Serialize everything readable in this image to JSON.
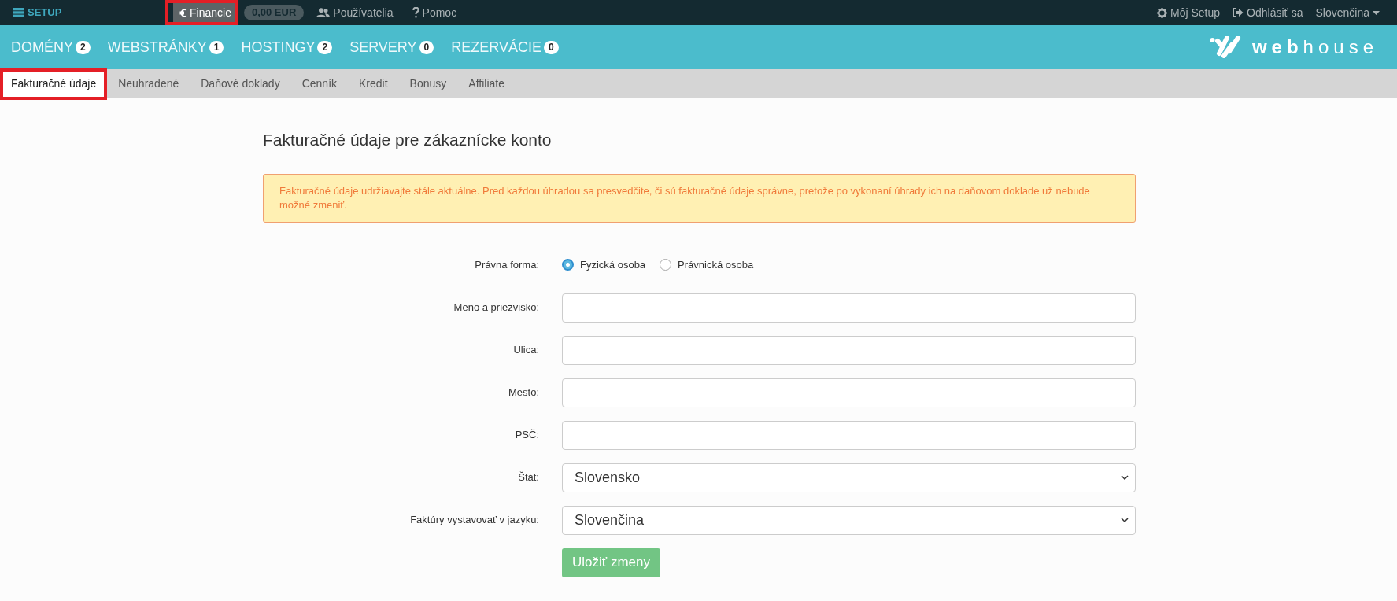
{
  "topbar": {
    "brand": "SETUP",
    "items": [
      {
        "kind": "link",
        "label": "Financie",
        "selected": true
      },
      {
        "kind": "badge",
        "label": "0,00 EUR",
        "selected": false
      },
      {
        "kind": "link",
        "label": "Používatelia",
        "selected": false
      },
      {
        "kind": "link",
        "label": "Pomoc",
        "selected": false
      }
    ],
    "right_items": [
      {
        "label": "Môj Setup"
      },
      {
        "label": "Odhlásiť sa"
      },
      {
        "label": "Slovenčina"
      }
    ]
  },
  "main_nav": [
    {
      "label": "DOMÉNY",
      "count": "2"
    },
    {
      "label": "WEBSTRÁNKY",
      "count": "1"
    },
    {
      "label": "HOSTINGY",
      "count": "2"
    },
    {
      "label": "SERVERY",
      "count": "0"
    },
    {
      "label": "REZERVÁCIE",
      "count": "0"
    }
  ],
  "logo": {
    "text_bold": "web",
    "text_light": "house"
  },
  "sub_tabs": [
    {
      "label": "Fakturačné údaje",
      "selected": true
    },
    {
      "label": "Neuhradené",
      "selected": false
    },
    {
      "label": "Daňové doklady",
      "selected": false
    },
    {
      "label": "Cenník",
      "selected": false
    },
    {
      "label": "Kredit",
      "selected": false
    },
    {
      "label": "Bonusy",
      "selected": false
    },
    {
      "label": "Affiliate",
      "selected": false
    }
  ],
  "page_title": "Fakturačné údaje pre zákaznícke konto",
  "alert": "Fakturačné údaje udržiavajte stále aktuálne. Pred každou úhradou sa presvedčite, či sú fakturačné údaje správne, pretože po vykonaní úhrady ich na daňovom doklade už nebude možné zmeniť.",
  "form": {
    "rows": [
      {
        "kind": "radio",
        "label": "Právna forma:",
        "options": [
          {
            "label": "Fyzická osoba",
            "selected": true
          },
          {
            "label": "Právnická osoba",
            "selected": false
          }
        ]
      },
      {
        "kind": "input",
        "label": "Meno a priezvisko:"
      },
      {
        "kind": "input",
        "label": "Ulica:"
      },
      {
        "kind": "input",
        "label": "Mesto:"
      },
      {
        "kind": "input",
        "label": "PSČ:"
      },
      {
        "kind": "select",
        "label": "Štát:",
        "value": "Slovensko"
      },
      {
        "kind": "select",
        "label": "Faktúry vystavovať v jazyku:",
        "value": "Slovenčina"
      }
    ],
    "submit": "Uložiť zmeny"
  }
}
